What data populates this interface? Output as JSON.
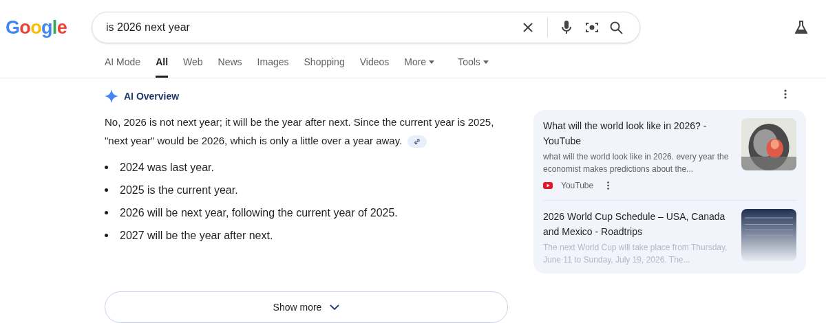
{
  "logo": {
    "letters": [
      {
        "char": "G",
        "color": "#4285f4"
      },
      {
        "char": "o",
        "color": "#ea4335"
      },
      {
        "char": "o",
        "color": "#fbbc05"
      },
      {
        "char": "g",
        "color": "#4285f4"
      },
      {
        "char": "l",
        "color": "#34a853"
      },
      {
        "char": "e",
        "color": "#ea4335"
      }
    ]
  },
  "search": {
    "value": "is 2026 next year"
  },
  "tabs": [
    {
      "label": "AI Mode",
      "selected": false,
      "kind": "plain"
    },
    {
      "label": "All",
      "selected": true,
      "kind": "plain"
    },
    {
      "label": "Web",
      "selected": false,
      "kind": "plain"
    },
    {
      "label": "News",
      "selected": false,
      "kind": "plain"
    },
    {
      "label": "Images",
      "selected": false,
      "kind": "plain"
    },
    {
      "label": "Shopping",
      "selected": false,
      "kind": "plain"
    },
    {
      "label": "Videos",
      "selected": false,
      "kind": "plain"
    },
    {
      "label": "More",
      "selected": false,
      "kind": "menu"
    },
    {
      "label": "Tools",
      "selected": false,
      "kind": "menu"
    }
  ],
  "overview": {
    "title": "AI Overview",
    "summary": "No, 2026 is not next year; it will be the year after next. Since the current year is 2025, \"next year\" would be 2026, which is only a little over a year away.",
    "bullets": [
      "2024 was last year.",
      "2025 is the current year.",
      "2026 will be next year, following the current year of 2025.",
      "2027 will be the year after next."
    ],
    "show_more": "Show more"
  },
  "sources": [
    {
      "title": "What will the world look like in 2026? - YouTube",
      "snippet": "what will the world look like in 2026. every year the economist makes predictions about the...",
      "site": "YouTube",
      "faded": false
    },
    {
      "title": "2026 World Cup Schedule – USA, Canada and Mexico - Roadtrips",
      "snippet": "The next World Cup will take place from Thursday, June 11 to Sunday, July 19, 2026. The...",
      "faded": true
    }
  ]
}
